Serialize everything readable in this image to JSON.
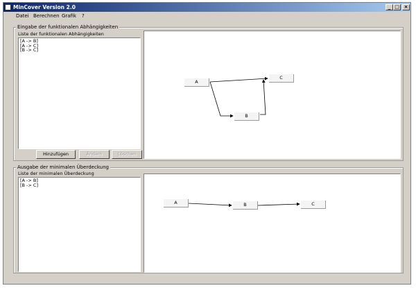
{
  "window": {
    "title": "MinCover Version 2.0",
    "min_label": "_",
    "max_label": "□",
    "close_label": "×"
  },
  "menu": [
    "Datei",
    "Berechnen",
    "Grafik",
    "?"
  ],
  "input_section": {
    "caption": "Eingabe der funktionalen Abhängigkeiten",
    "list_label": "Liste der funktionalen Abhängigkeiten",
    "items": [
      "[A -> B]",
      "[A -> C]",
      "[B -> C]"
    ],
    "buttons": {
      "add": "Hinzufügen",
      "edit": "Ändern",
      "delete": "Löschen"
    },
    "graph": {
      "nodes": [
        {
          "id": "A",
          "label": "A"
        },
        {
          "id": "B",
          "label": "B"
        },
        {
          "id": "C",
          "label": "C"
        }
      ],
      "edges": [
        [
          "A",
          "B"
        ],
        [
          "A",
          "C"
        ],
        [
          "B",
          "C"
        ]
      ]
    }
  },
  "output_section": {
    "caption": "Ausgabe der minimalen Überdeckung",
    "list_label": "Liste der minimalen Überdeckung",
    "items": [
      "[A -> B]",
      "[B -> C]"
    ],
    "graph": {
      "nodes": [
        {
          "id": "A",
          "label": "A"
        },
        {
          "id": "B",
          "label": "B"
        },
        {
          "id": "C",
          "label": "C"
        }
      ],
      "edges": [
        [
          "A",
          "B"
        ],
        [
          "B",
          "C"
        ]
      ]
    }
  }
}
